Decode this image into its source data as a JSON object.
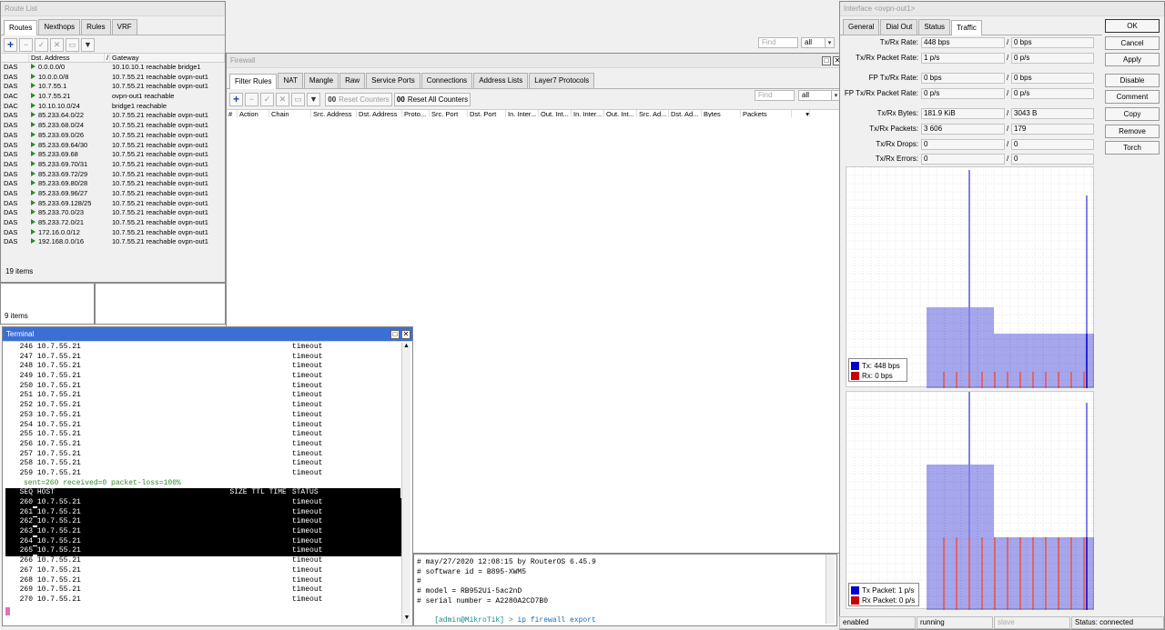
{
  "routes_window": {
    "title": "Route List",
    "tabs": [
      "Routes",
      "Nexthops",
      "Rules",
      "VRF"
    ],
    "find_placeholder": "Find",
    "filter": "all",
    "columns": [
      "",
      "Dst. Address",
      "/",
      "Gateway"
    ],
    "rows": [
      [
        "DAS",
        "0.0.0.0/0",
        "10.10.10.1 reachable bridge1"
      ],
      [
        "DAS",
        "10.0.0.0/8",
        "10.7.55.21 reachable ovpn-out1"
      ],
      [
        "DAS",
        "10.7.55.1",
        "10.7.55.21 reachable ovpn-out1"
      ],
      [
        "DAC",
        "10.7.55.21",
        "ovpn-out1 reachable"
      ],
      [
        "DAC",
        "10.10.10.0/24",
        "bridge1 reachable"
      ],
      [
        "DAS",
        "85.233.64.0/22",
        "10.7.55.21 reachable ovpn-out1"
      ],
      [
        "DAS",
        "85.233.68.0/24",
        "10.7.55.21 reachable ovpn-out1"
      ],
      [
        "DAS",
        "85.233.69.0/26",
        "10.7.55.21 reachable ovpn-out1"
      ],
      [
        "DAS",
        "85.233.69.64/30",
        "10.7.55.21 reachable ovpn-out1"
      ],
      [
        "DAS",
        "85.233.69.68",
        "10.7.55.21 reachable ovpn-out1"
      ],
      [
        "DAS",
        "85.233.69.70/31",
        "10.7.55.21 reachable ovpn-out1"
      ],
      [
        "DAS",
        "85.233.69.72/29",
        "10.7.55.21 reachable ovpn-out1"
      ],
      [
        "DAS",
        "85.233.69.80/28",
        "10.7.55.21 reachable ovpn-out1"
      ],
      [
        "DAS",
        "85.233.69.96/27",
        "10.7.55.21 reachable ovpn-out1"
      ],
      [
        "DAS",
        "85.233.69.128/25",
        "10.7.55.21 reachable ovpn-out1"
      ],
      [
        "DAS",
        "85.233.70.0/23",
        "10.7.55.21 reachable ovpn-out1"
      ],
      [
        "DAS",
        "85.233.72.0/21",
        "10.7.55.21 reachable ovpn-out1"
      ],
      [
        "DAS",
        "172.16.0.0/12",
        "10.7.55.21 reachable ovpn-out1"
      ],
      [
        "DAS",
        "192.168.0.0/16",
        "10.7.55.21 reachable ovpn-out1"
      ]
    ],
    "count": "19 items"
  },
  "small_window": {
    "count": "9 items"
  },
  "firewall": {
    "title": "Firewall",
    "tabs": [
      "Filter Rules",
      "NAT",
      "Mangle",
      "Raw",
      "Service Ports",
      "Connections",
      "Address Lists",
      "Layer7 Protocols"
    ],
    "reset_counters": "Reset Counters",
    "reset_all": "Reset All Counters",
    "counter_icon": "00",
    "find_placeholder": "Find",
    "filter": "all",
    "columns": [
      "#",
      "Action",
      "Chain",
      "Src. Address",
      "Dst. Address",
      "Proto...",
      "Src. Port",
      "Dst. Port",
      "In. Inter...",
      "Out. Int...",
      "In. Inter...",
      "Out. Int...",
      "Src. Ad...",
      "Dst. Ad...",
      "Bytes",
      "Packets"
    ]
  },
  "terminal": {
    "title": "Terminal",
    "lines_a": [
      [
        "246",
        "10.7.55.21",
        "timeout"
      ],
      [
        "247",
        "10.7.55.21",
        "timeout"
      ],
      [
        "248",
        "10.7.55.21",
        "timeout"
      ],
      [
        "249",
        "10.7.55.21",
        "timeout"
      ],
      [
        "250",
        "10.7.55.21",
        "timeout"
      ],
      [
        "251",
        "10.7.55.21",
        "timeout"
      ],
      [
        "252",
        "10.7.55.21",
        "timeout"
      ],
      [
        "253",
        "10.7.55.21",
        "timeout"
      ],
      [
        "254",
        "10.7.55.21",
        "timeout"
      ],
      [
        "255",
        "10.7.55.21",
        "timeout"
      ],
      [
        "256",
        "10.7.55.21",
        "timeout"
      ],
      [
        "257",
        "10.7.55.21",
        "timeout"
      ],
      [
        "258",
        "10.7.55.21",
        "timeout"
      ],
      [
        "259",
        "10.7.55.21",
        "timeout"
      ]
    ],
    "summary": "sent=260 received=0 packet-loss=100%",
    "header": {
      "seq": "SEQ",
      "host": "HOST",
      "cols": "SIZE TTL TIME",
      "status": "STATUS"
    },
    "lines_b": [
      [
        "260",
        "10.7.55.21",
        "timeout"
      ],
      [
        "261",
        "10.7.55.21",
        "timeout"
      ],
      [
        "262",
        "10.7.55.21",
        "timeout"
      ],
      [
        "263",
        "10.7.55.21",
        "timeout"
      ],
      [
        "264",
        "10.7.55.21",
        "timeout"
      ],
      [
        "265",
        "10.7.55.21",
        "timeout"
      ],
      [
        "266",
        "10.7.55.21",
        "timeout"
      ],
      [
        "267",
        "10.7.55.21",
        "timeout"
      ],
      [
        "268",
        "10.7.55.21",
        "timeout"
      ],
      [
        "269",
        "10.7.55.21",
        "timeout"
      ],
      [
        "270",
        "10.7.55.21",
        "timeout"
      ]
    ]
  },
  "terminal2": {
    "lines": [
      "# may/27/2020 12:08:15 by RouterOS 6.45.9",
      "# software id = B895-XWM5",
      "#",
      "# model = RB952Ui-5ac2nD",
      "# serial number = A2280A2CD7B0"
    ],
    "prompt": "[admin@MikroTik] > ",
    "command": "ip firewall export"
  },
  "interface": {
    "title": "Interface <ovpn-out1>",
    "tabs": [
      "General",
      "Dial Out",
      "Status",
      "Traffic"
    ],
    "fields": [
      {
        "label": "Tx/Rx Rate:",
        "tx": "448 bps",
        "rx": "0 bps"
      },
      {
        "label": "Tx/Rx Packet Rate:",
        "tx": "1 p/s",
        "rx": "0 p/s"
      },
      {
        "label": "FP Tx/Rx Rate:",
        "tx": "0 bps",
        "rx": "0 bps"
      },
      {
        "label": "FP Tx/Rx Packet Rate:",
        "tx": "0 p/s",
        "rx": "0 p/s"
      },
      {
        "label": "Tx/Rx Bytes:",
        "tx": "181.9 KiB",
        "rx": "3043 B"
      },
      {
        "label": "Tx/Rx Packets:",
        "tx": "3 606",
        "rx": "179"
      },
      {
        "label": "Tx/Rx Drops:",
        "tx": "0",
        "rx": "0"
      },
      {
        "label": "Tx/Rx Errors:",
        "tx": "0",
        "rx": "0"
      }
    ],
    "buttons": [
      "OK",
      "Cancel",
      "Apply",
      "Disable",
      "Comment",
      "Copy",
      "Remove",
      "Torch"
    ],
    "legend1": {
      "tx": "Tx:  448 bps",
      "rx": "Rx:  0 bps"
    },
    "legend2": {
      "tx": "Tx Packet:  1 p/s",
      "rx": "Rx Packet:  0 p/s"
    },
    "status": [
      "enabled",
      "running",
      "slave",
      "Status: connected"
    ],
    "colors": {
      "tx": "#0000cc",
      "rx": "#cc0000"
    }
  }
}
